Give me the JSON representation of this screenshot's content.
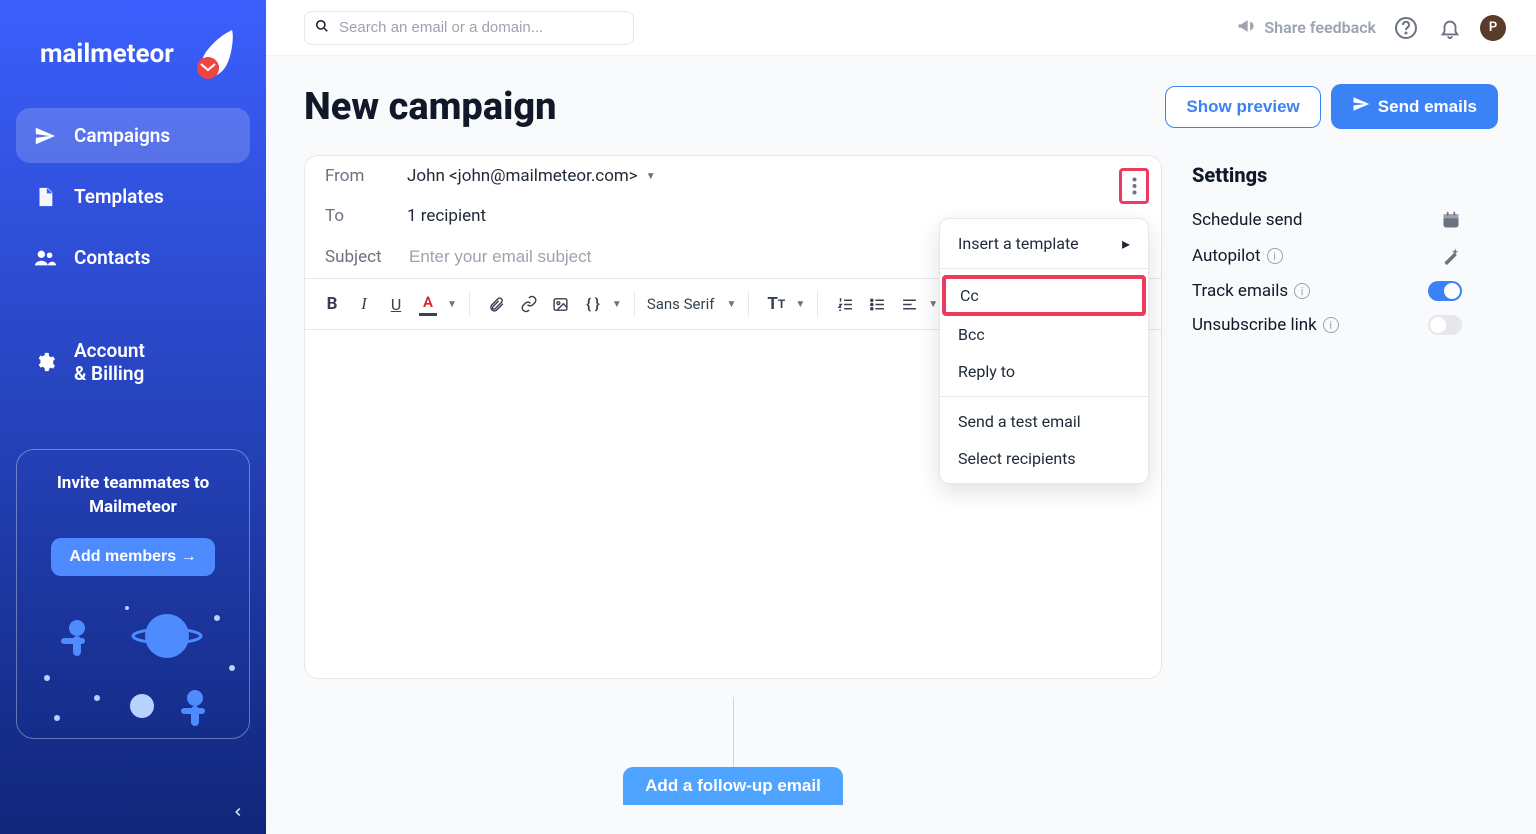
{
  "brand": {
    "name": "mailmeteor"
  },
  "nav": {
    "campaigns": "Campaigns",
    "templates": "Templates",
    "contacts": "Contacts",
    "account_line1": "Account",
    "account_line2": "& Billing"
  },
  "invite_card": {
    "line1": "Invite teammates to",
    "line2": "Mailmeteor",
    "button": "Add members →"
  },
  "search": {
    "placeholder": "Search an email or a domain..."
  },
  "topbar": {
    "feedback": "Share feedback",
    "avatar_initial": "P"
  },
  "page": {
    "title": "New campaign",
    "show_preview": "Show preview",
    "send_emails": "Send emails"
  },
  "composer": {
    "from_label": "From",
    "from_value": "John <john@mailmeteor.com>",
    "to_label": "To",
    "to_value": "1 recipient",
    "subject_label": "Subject",
    "subject_placeholder": "Enter your email subject",
    "font_family": "Sans Serif"
  },
  "dropdown": {
    "insert_template": "Insert a template",
    "cc": "Cc",
    "bcc": "Bcc",
    "reply_to": "Reply to",
    "send_test": "Send a test email",
    "select_recipients": "Select recipients"
  },
  "settings": {
    "title": "Settings",
    "schedule_send": "Schedule send",
    "autopilot": "Autopilot",
    "track_emails": "Track emails",
    "unsubscribe_link": "Unsubscribe link"
  },
  "followup": {
    "label": "Add a follow-up email"
  }
}
